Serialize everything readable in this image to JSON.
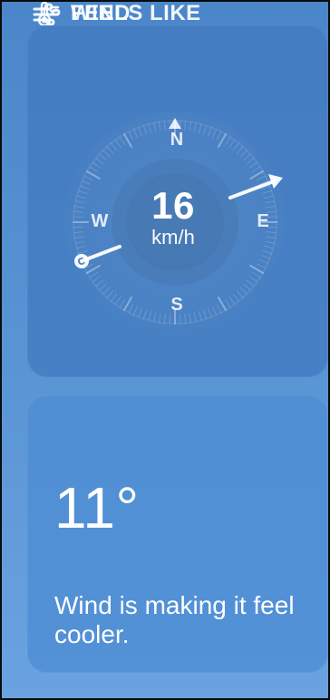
{
  "wind_card": {
    "title": "WIND",
    "icon": "wind-icon",
    "speed_value": "16",
    "speed_unit": "km/h",
    "cardinal": {
      "north": "N",
      "east": "E",
      "south": "S",
      "west": "W"
    },
    "direction_icon": "direction-arrow-icon"
  },
  "feels_like_card": {
    "title": "FEELS LIKE",
    "icon": "thermometer-icon",
    "temperature": "11°",
    "description": "Wind is making it feel cooler."
  },
  "colors": {
    "background_top": "#4a86c9",
    "background_bottom": "#6aa3df",
    "card_wind": "#4179bd",
    "card_feels": "#4c8cd3",
    "text": "#ffffff"
  }
}
